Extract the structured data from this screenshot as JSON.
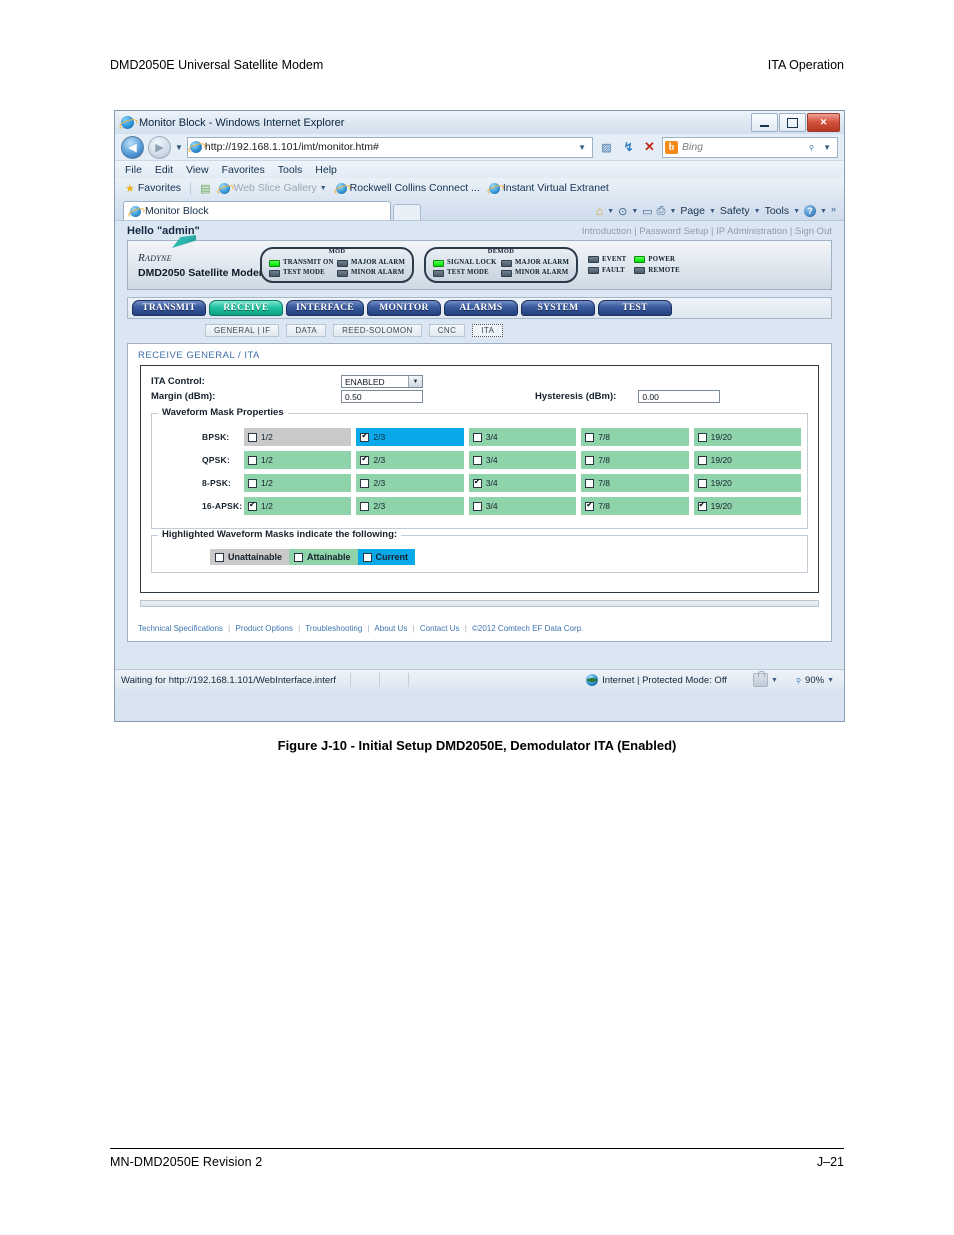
{
  "document": {
    "header_left": "DMD2050E Universal Satellite Modem",
    "header_right": "ITA Operation",
    "figure_caption": "Figure J-10 - Initial Setup DMD2050E, Demodulator ITA (Enabled)",
    "footer_left": "MN-DMD2050E   Revision 2",
    "footer_right": "J–21"
  },
  "browser": {
    "title": "Monitor Block - Windows Internet Explorer",
    "window_controls": {
      "minimize": "—",
      "maximize": "□",
      "close": "✕"
    },
    "address": {
      "url": "http://192.168.1.101/imt/monitor.htm#",
      "dropdown_caret": "▾",
      "compat_icon": "compatibility-view-icon",
      "refresh_icon": "↻",
      "stop_icon": "✕"
    },
    "search": {
      "provider": "Bing",
      "provider_initial": "b",
      "caret": "▾"
    },
    "menu": [
      "File",
      "Edit",
      "View",
      "Favorites",
      "Tools",
      "Help"
    ],
    "favorites_bar": {
      "favorites_label": "Favorites",
      "items": [
        "Web Slice Gallery",
        "Rockwell Collins Connect ...",
        "Instant Virtual Extranet"
      ]
    },
    "tab_label": "Monitor Block",
    "command_bar": [
      "Page",
      "Safety",
      "Tools"
    ],
    "status_bar": {
      "message": "Waiting for http://192.168.1.101/WebInterface.interf",
      "zone": "Internet | Protected Mode: Off",
      "zoom": "90%"
    }
  },
  "webapp": {
    "greeting": "Hello \"admin\"",
    "header_links": [
      "Introduction",
      "Password Setup",
      "IP Administration",
      "Sign Out"
    ],
    "brand": {
      "logo_text": "Radyne",
      "product": "DMD2050 Satellite Modem"
    },
    "led_groups": [
      {
        "title": "MOD",
        "leds": [
          {
            "label": "TRANSMIT ON",
            "state": "on"
          },
          {
            "label": "MAJOR ALARM",
            "state": "off"
          },
          {
            "label": "TEST MODE",
            "state": "off"
          },
          {
            "label": "MINOR ALARM",
            "state": "off"
          }
        ]
      },
      {
        "title": "DEMOD",
        "leds": [
          {
            "label": "SIGNAL LOCK",
            "state": "on"
          },
          {
            "label": "MAJOR ALARM",
            "state": "off"
          },
          {
            "label": "TEST MODE",
            "state": "off"
          },
          {
            "label": "MINOR ALARM",
            "state": "off"
          }
        ]
      }
    ],
    "status_leds": [
      {
        "label": "EVENT",
        "state": "off"
      },
      {
        "label": "POWER",
        "state": "on"
      },
      {
        "label": "FAULT",
        "state": "off"
      },
      {
        "label": "REMOTE",
        "state": "off"
      }
    ],
    "nav_tabs": [
      {
        "label": "TRANSMIT",
        "active": false
      },
      {
        "label": "RECEIVE",
        "active": true
      },
      {
        "label": "INTERFACE",
        "active": false
      },
      {
        "label": "MONITOR",
        "active": false
      },
      {
        "label": "ALARMS",
        "active": false
      },
      {
        "label": "SYSTEM",
        "active": false
      },
      {
        "label": "TEST",
        "active": false
      }
    ],
    "sub_tabs": [
      {
        "label": "GENERAL | IF",
        "active": false
      },
      {
        "label": "DATA",
        "active": false
      },
      {
        "label": "REED-SOLOMON",
        "active": false
      },
      {
        "label": "CNC",
        "active": false
      },
      {
        "label": "ITA",
        "active": true
      }
    ],
    "page_title": "RECEIVE GENERAL / ITA",
    "form": {
      "ita_control_label": "ITA Control:",
      "ita_control_value": "ENABLED",
      "margin_label": "Margin (dBm):",
      "margin_value": "0.50",
      "hysteresis_label": "Hysteresis (dBm):",
      "hysteresis_value": "0.00"
    },
    "mask": {
      "legend": "Waveform Mask Properties",
      "rates": [
        "1/2",
        "2/3",
        "3/4",
        "7/8",
        "19/20"
      ],
      "rows": [
        {
          "modulation": "BPSK:",
          "cells": [
            {
              "rate": "1/2",
              "state": "unattainable",
              "checked": false
            },
            {
              "rate": "2/3",
              "state": "current",
              "checked": true
            },
            {
              "rate": "3/4",
              "state": "attainable",
              "checked": false
            },
            {
              "rate": "7/8",
              "state": "attainable",
              "checked": false
            },
            {
              "rate": "19/20",
              "state": "attainable",
              "checked": false
            }
          ]
        },
        {
          "modulation": "QPSK:",
          "cells": [
            {
              "rate": "1/2",
              "state": "attainable",
              "checked": false
            },
            {
              "rate": "2/3",
              "state": "attainable",
              "checked": true
            },
            {
              "rate": "3/4",
              "state": "attainable",
              "checked": false
            },
            {
              "rate": "7/8",
              "state": "attainable",
              "checked": false
            },
            {
              "rate": "19/20",
              "state": "attainable",
              "checked": false
            }
          ]
        },
        {
          "modulation": "8-PSK:",
          "cells": [
            {
              "rate": "1/2",
              "state": "attainable",
              "checked": false
            },
            {
              "rate": "2/3",
              "state": "attainable",
              "checked": false
            },
            {
              "rate": "3/4",
              "state": "attainable",
              "checked": true
            },
            {
              "rate": "7/8",
              "state": "attainable",
              "checked": false
            },
            {
              "rate": "19/20",
              "state": "attainable",
              "checked": false
            }
          ]
        },
        {
          "modulation": "16-APSK:",
          "cells": [
            {
              "rate": "1/2",
              "state": "attainable",
              "checked": true
            },
            {
              "rate": "2/3",
              "state": "attainable",
              "checked": false
            },
            {
              "rate": "3/4",
              "state": "attainable",
              "checked": false
            },
            {
              "rate": "7/8",
              "state": "attainable",
              "checked": true
            },
            {
              "rate": "19/20",
              "state": "attainable",
              "checked": true
            }
          ]
        }
      ]
    },
    "legend": {
      "title": "Highlighted Waveform Masks indicate the following:",
      "items": [
        {
          "label": "Unattainable",
          "state": "unattainable"
        },
        {
          "label": "Attainable",
          "state": "attainable"
        },
        {
          "label": "Current",
          "state": "current"
        }
      ]
    },
    "footer_links": [
      "Technical Specifications",
      "Product Options",
      "Troubleshooting",
      "About Us",
      "Contact Us"
    ],
    "footer_copyright": "©2012 Comtech EF Data Corp."
  },
  "colors": {
    "attainable": "#8fd3ab",
    "unattainable": "#c9c9c9",
    "current": "#0aa8e8",
    "tab_active": "#22c4a3",
    "tab_inactive": "#3a5ba0",
    "led_on": "#00df00",
    "led_off": "#4a5a68"
  }
}
